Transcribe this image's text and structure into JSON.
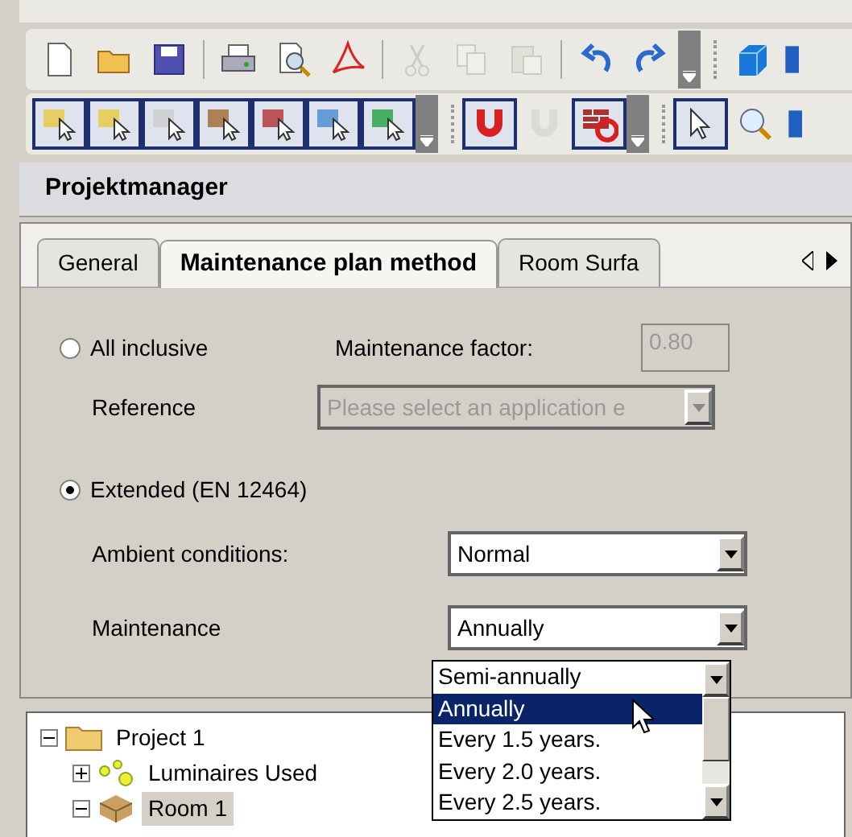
{
  "toolbars": [
    {
      "items": [
        {
          "kind": "new",
          "disabled": false
        },
        {
          "kind": "open",
          "disabled": false
        },
        {
          "kind": "save",
          "disabled": false
        },
        {
          "kind": "separator"
        },
        {
          "kind": "print",
          "disabled": false
        },
        {
          "kind": "preview",
          "disabled": false
        },
        {
          "kind": "pdf",
          "disabled": false
        },
        {
          "kind": "separator"
        },
        {
          "kind": "cut",
          "disabled": true
        },
        {
          "kind": "copy",
          "disabled": true
        },
        {
          "kind": "paste",
          "disabled": true
        },
        {
          "kind": "separator"
        },
        {
          "kind": "undo",
          "disabled": false
        },
        {
          "kind": "redo",
          "disabled": false
        },
        {
          "kind": "overflow"
        },
        {
          "kind": "grip"
        },
        {
          "kind": "cube",
          "disabled": false
        },
        {
          "kind": "partial",
          "disabled": false
        }
      ]
    },
    {
      "items": [
        {
          "kind": "select-luminaire-group",
          "selected": true
        },
        {
          "kind": "select-luminaire",
          "selected": true
        },
        {
          "kind": "select-object",
          "selected": true
        },
        {
          "kind": "select-furniture",
          "selected": true
        },
        {
          "kind": "select-wall",
          "selected": true
        },
        {
          "kind": "select-area",
          "selected": true
        },
        {
          "kind": "select-point",
          "selected": true
        },
        {
          "kind": "overflow"
        },
        {
          "kind": "grip"
        },
        {
          "kind": "magnet",
          "selected": true
        },
        {
          "kind": "dxf-magnet",
          "selected": false,
          "disabled": true
        },
        {
          "kind": "wall-magnet",
          "selected": true
        },
        {
          "kind": "overflow"
        },
        {
          "kind": "grip"
        },
        {
          "kind": "pointer",
          "selected": true
        },
        {
          "kind": "zoom",
          "selected": false
        },
        {
          "kind": "partial",
          "selected": false
        }
      ]
    }
  ],
  "panel": {
    "title": "Projektmanager"
  },
  "tabs": [
    {
      "label": "General",
      "selected": false
    },
    {
      "label": "Maintenance plan method",
      "selected": true
    },
    {
      "label": "Room Surfa",
      "selected": false
    }
  ],
  "form": {
    "all_inclusive": {
      "label": "All inclusive",
      "selected": false
    },
    "maintenance_factor": {
      "label": "Maintenance factor:",
      "value": "0.80",
      "disabled": true
    },
    "reference": {
      "label": "Reference",
      "value": "Please select an application e",
      "disabled": true
    },
    "extended": {
      "label": "Extended (EN 12464)",
      "selected": true
    },
    "ambient": {
      "label": "Ambient conditions:",
      "value": "Normal"
    },
    "maintenance": {
      "label": "Maintenance",
      "value": "Annually",
      "expanded": true,
      "options": [
        {
          "label": "Semi-annually",
          "selected": false
        },
        {
          "label": "Annually",
          "selected": true
        },
        {
          "label": "Every 1.5 years.",
          "selected": false
        },
        {
          "label": "Every 2.0 years.",
          "selected": false
        },
        {
          "label": "Every 2.5 years.",
          "selected": false
        }
      ]
    }
  },
  "tree": [
    {
      "label": "Project 1",
      "kind": "folder",
      "expanded": true,
      "selected": false,
      "children": [
        {
          "label": "Luminaires Used",
          "kind": "luminaires",
          "expanded": false,
          "selected": false
        },
        {
          "label": "Room 1",
          "kind": "room",
          "expanded": true,
          "selected": true
        }
      ]
    }
  ]
}
